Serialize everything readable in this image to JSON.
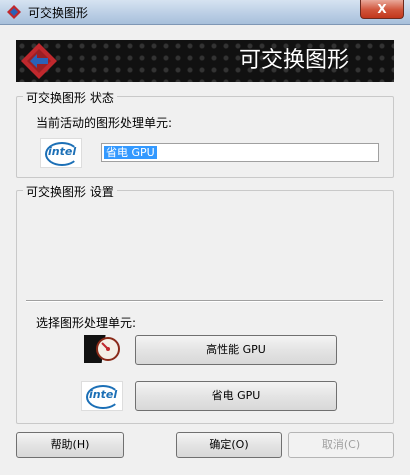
{
  "window": {
    "title": "可交换图形",
    "close_glyph": "X"
  },
  "banner": {
    "title": "可交换图形",
    "logo_icon": "switchable-graphics-logo-icon"
  },
  "status_group": {
    "label": "可交换图形 状态",
    "active_label": "当前活动的图形处理单元:",
    "active_value": "省电 GPU",
    "vendor_logo_text": "intel"
  },
  "settings_group": {
    "label": "可交换图形 设置",
    "select_label": "选择图形处理单元:",
    "high_perf_button": "高性能 GPU",
    "power_save_button": "省电 GPU",
    "intel_logo_text": "intel"
  },
  "footer": {
    "help_button": "帮助(H)",
    "ok_button": "确定(O)",
    "cancel_button": "取消(C)"
  },
  "colors": {
    "banner_bg": "#111111",
    "selection": "#3399ff",
    "intel_blue": "#1b6fb6"
  }
}
